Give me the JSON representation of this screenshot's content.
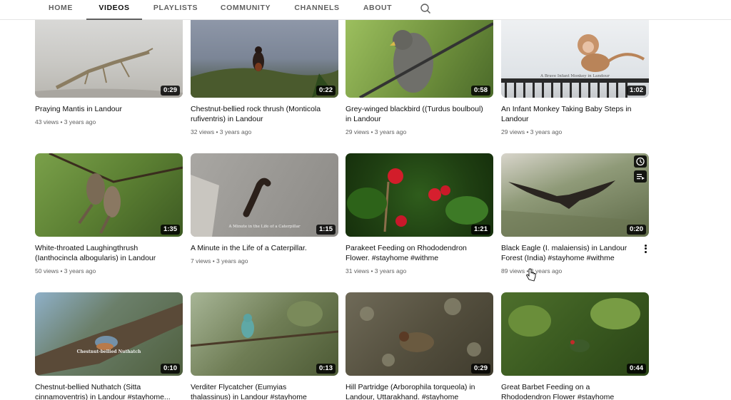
{
  "tabs": [
    {
      "label": "HOME"
    },
    {
      "label": "VIDEOS",
      "active": true
    },
    {
      "label": "PLAYLISTS"
    },
    {
      "label": "COMMUNITY"
    },
    {
      "label": "CHANNELS"
    },
    {
      "label": "ABOUT"
    }
  ],
  "search_icon": "search-icon",
  "videos": [
    {
      "title": "Praying Mantis in Landour",
      "views": "43 views",
      "age": "3 years ago",
      "duration": "0:29"
    },
    {
      "title": "Chestnut-bellied rock thrush (Monticola rufiventris) in Landour",
      "views": "32 views",
      "age": "3 years ago",
      "duration": "0:22"
    },
    {
      "title": "Grey-winged blackbird ((Turdus boulboul) in Landour",
      "views": "29 views",
      "age": "3 years ago",
      "duration": "0:58"
    },
    {
      "title": "An Infant Monkey Taking Baby Steps in Landour",
      "views": "29 views",
      "age": "3 years ago",
      "duration": "1:02",
      "overlay": "A Brave Infant Monkey in Landour"
    },
    {
      "title": "White-throated Laughingthrush (Ianthocincla albogularis) in Landour",
      "views": "50 views",
      "age": "3 years ago",
      "duration": "1:35"
    },
    {
      "title": "A Minute in the Life of a Caterpillar.",
      "views": "7 views",
      "age": "3 years ago",
      "duration": "1:15",
      "overlay": "A Minute in the Life of a Caterpillar"
    },
    {
      "title": "Parakeet Feeding on Rhododendron Flower. #stayhome #withme",
      "views": "31 views",
      "age": "3 years ago",
      "duration": "1:21"
    },
    {
      "title": "Black Eagle (I. malaiensis) in Landour Forest (India) #stayhome #withme",
      "views": "89 views",
      "age": "3 years ago",
      "duration": "0:20",
      "hovered": true
    },
    {
      "title": "Chestnut-bellied Nuthatch (Sitta cinnamoventris) in Landour #stayhome...",
      "views": "",
      "age": "",
      "duration": "0:10",
      "overlay": "Chestnut-bellied Nuthatch"
    },
    {
      "title": "Verditer Flycatcher (Eumyias thalassinus) in Landour #stayhome #withme",
      "views": "",
      "age": "",
      "duration": "0:13"
    },
    {
      "title": "Hill Partridge (Arborophila torqueola) in Landour, Uttarakhand. #stayhome #withme",
      "views": "",
      "age": "",
      "duration": "0:29"
    },
    {
      "title": "Great Barbet Feeding on a Rhododendron Flower #stayhome #withme",
      "views": "",
      "age": "",
      "duration": "0:44"
    }
  ],
  "meta_separator": " • ",
  "hover_actions": [
    "watch-later-icon",
    "add-to-queue-icon"
  ],
  "colors": {
    "text_primary": "#0f0f0f",
    "text_secondary": "#606060",
    "tab_underline": "#606060"
  }
}
